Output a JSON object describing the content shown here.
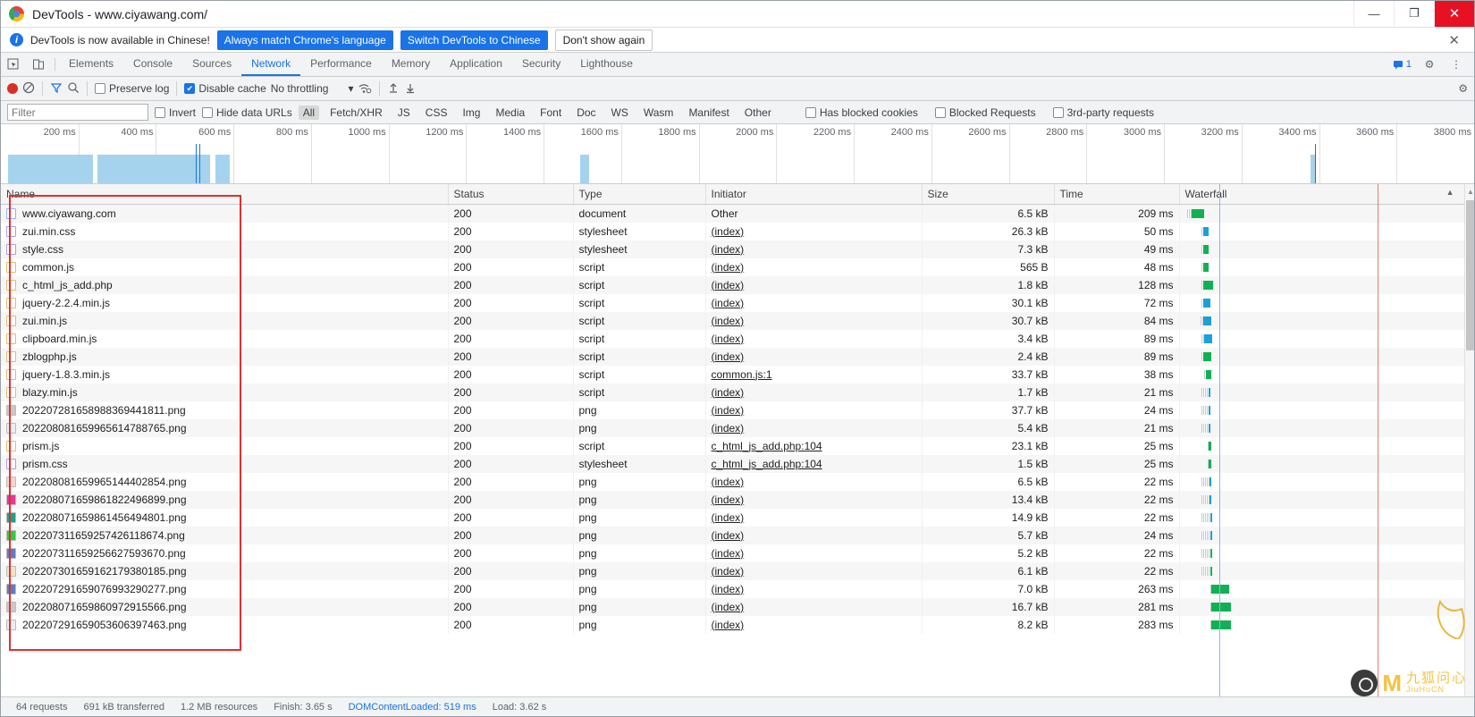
{
  "window": {
    "title": "DevTools - www.ciyawang.com/",
    "minimize": "—",
    "maximize": "❐",
    "close": "✕"
  },
  "banner": {
    "text": "DevTools is now available in Chinese!",
    "primary_button": "Always match Chrome's language",
    "secondary_button": "Switch DevTools to Chinese",
    "dismiss_button": "Don't show again",
    "close": "✕"
  },
  "tabs": [
    {
      "label": "Elements",
      "active": false
    },
    {
      "label": "Console",
      "active": false
    },
    {
      "label": "Sources",
      "active": false
    },
    {
      "label": "Network",
      "active": true
    },
    {
      "label": "Performance",
      "active": false
    },
    {
      "label": "Memory",
      "active": false
    },
    {
      "label": "Application",
      "active": false
    },
    {
      "label": "Security",
      "active": false
    },
    {
      "label": "Lighthouse",
      "active": false
    }
  ],
  "tabbar_right": {
    "message_count": "1",
    "settings": "⚙",
    "more": "⋮"
  },
  "net_toolbar": {
    "record_title": "record",
    "clear_title": "clear",
    "filter_title": "filter",
    "search_title": "search",
    "preserve_log": {
      "label": "Preserve log",
      "checked": false
    },
    "disable_cache": {
      "label": "Disable cache",
      "checked": true
    },
    "throttling": "No throttling",
    "throttle_caret": "▾",
    "import_title": "import HAR",
    "export_title": "export HAR",
    "settings": "⚙"
  },
  "filter_bar": {
    "placeholder": "Filter",
    "value": "",
    "invert": {
      "label": "Invert",
      "checked": false
    },
    "hide_data_urls": {
      "label": "Hide data URLs",
      "checked": false
    },
    "types": [
      "All",
      "Fetch/XHR",
      "JS",
      "CSS",
      "Img",
      "Media",
      "Font",
      "Doc",
      "WS",
      "Wasm",
      "Manifest",
      "Other"
    ],
    "active_type": "All",
    "has_blocked_cookies": {
      "label": "Has blocked cookies",
      "checked": false
    },
    "blocked_requests": {
      "label": "Blocked Requests",
      "checked": false
    },
    "third_party": {
      "label": "3rd-party requests",
      "checked": false
    }
  },
  "overview": {
    "ticks": [
      "200 ms",
      "400 ms",
      "600 ms",
      "800 ms",
      "1000 ms",
      "1200 ms",
      "1400 ms",
      "1600 ms",
      "1800 ms",
      "2000 ms",
      "2200 ms",
      "2400 ms",
      "2600 ms",
      "2800 ms",
      "3000 ms",
      "3200 ms",
      "3400 ms",
      "3600 ms",
      "3800 ms"
    ]
  },
  "table": {
    "columns": [
      "Name",
      "Status",
      "Type",
      "Initiator",
      "Size",
      "Time",
      "Waterfall"
    ],
    "sort_indicator": "▲",
    "rows": [
      {
        "name": "www.ciyawang.com",
        "icon": "doc",
        "status": "200",
        "type": "document",
        "initiator": "Other",
        "initiator_link": false,
        "size": "6.5 kB",
        "time": "209 ms",
        "wf_start": 8,
        "wf_wait": 5,
        "wf_len": 14,
        "wf_color": "#11b153"
      },
      {
        "name": "zui.min.css",
        "icon": "css",
        "status": "200",
        "type": "stylesheet",
        "initiator": "(index)",
        "initiator_link": true,
        "size": "26.3 kB",
        "time": "50 ms",
        "wf_start": 24,
        "wf_wait": 2,
        "wf_len": 6,
        "wf_color": "#1ca0d9"
      },
      {
        "name": "style.css",
        "icon": "css",
        "status": "200",
        "type": "stylesheet",
        "initiator": "(index)",
        "initiator_link": true,
        "size": "7.3 kB",
        "time": "49 ms",
        "wf_start": 24,
        "wf_wait": 2,
        "wf_len": 6,
        "wf_color": "#11b153"
      },
      {
        "name": "common.js",
        "icon": "js",
        "status": "200",
        "type": "script",
        "initiator": "(index)",
        "initiator_link": true,
        "size": "565 B",
        "time": "48 ms",
        "wf_start": 24,
        "wf_wait": 2,
        "wf_len": 6,
        "wf_color": "#11b153"
      },
      {
        "name": "c_html_js_add.php",
        "icon": "js",
        "status": "200",
        "type": "script",
        "initiator": "(index)",
        "initiator_link": true,
        "size": "1.8 kB",
        "time": "128 ms",
        "wf_start": 24,
        "wf_wait": 2,
        "wf_len": 11,
        "wf_color": "#11b153"
      },
      {
        "name": "jquery-2.2.4.min.js",
        "icon": "js",
        "status": "200",
        "type": "script",
        "initiator": "(index)",
        "initiator_link": true,
        "size": "30.1 kB",
        "time": "72 ms",
        "wf_start": 24,
        "wf_wait": 2,
        "wf_len": 8,
        "wf_color": "#1ca0d9"
      },
      {
        "name": "zui.min.js",
        "icon": "js",
        "status": "200",
        "type": "script",
        "initiator": "(index)",
        "initiator_link": true,
        "size": "30.7 kB",
        "time": "84 ms",
        "wf_start": 23,
        "wf_wait": 3,
        "wf_len": 9,
        "wf_color": "#1ca0d9"
      },
      {
        "name": "clipboard.min.js",
        "icon": "js",
        "status": "200",
        "type": "script",
        "initiator": "(index)",
        "initiator_link": true,
        "size": "3.4 kB",
        "time": "89 ms",
        "wf_start": 24,
        "wf_wait": 3,
        "wf_len": 9,
        "wf_color": "#1ca0d9"
      },
      {
        "name": "zblogphp.js",
        "icon": "js",
        "status": "200",
        "type": "script",
        "initiator": "(index)",
        "initiator_link": true,
        "size": "2.4 kB",
        "time": "89 ms",
        "wf_start": 24,
        "wf_wait": 2,
        "wf_len": 9,
        "wf_color": "#11b153"
      },
      {
        "name": "jquery-1.8.3.min.js",
        "icon": "js",
        "status": "200",
        "type": "script",
        "initiator": "common.js:1",
        "initiator_link": true,
        "size": "33.7 kB",
        "time": "38 ms",
        "wf_start": 27,
        "wf_wait": 2,
        "wf_len": 6,
        "wf_color": "#11b153"
      },
      {
        "name": "blazy.min.js",
        "icon": "js",
        "status": "200",
        "type": "script",
        "initiator": "(index)",
        "initiator_link": true,
        "size": "1.7 kB",
        "time": "21 ms",
        "wf_start": 24,
        "wf_wait": 8,
        "wf_len": 2,
        "wf_color": "#1ca0d9"
      },
      {
        "name": "20220728165898836944 1811.png",
        "icon": "img",
        "status": "200",
        "type": "png",
        "initiator": "(index)",
        "initiator_link": true,
        "size": "37.7 kB",
        "time": "24 ms",
        "wf_start": 24,
        "wf_wait": 8,
        "wf_len": 2,
        "wf_color": "#1ca0d9"
      },
      {
        "name": "20220808165996561478 8765.png",
        "icon": "img",
        "status": "200",
        "type": "png",
        "initiator": "(index)",
        "initiator_link": true,
        "size": "5.4 kB",
        "time": "21 ms",
        "wf_start": 24,
        "wf_wait": 8,
        "wf_len": 2,
        "wf_color": "#1ca0d9"
      },
      {
        "name": "prism.js",
        "icon": "js",
        "status": "200",
        "type": "script",
        "initiator": "c_html_js_add.php:104",
        "initiator_link": true,
        "size": "23.1 kB",
        "time": "25 ms",
        "wf_start": 31,
        "wf_wait": 1,
        "wf_len": 3,
        "wf_color": "#11b153"
      },
      {
        "name": "prism.css",
        "icon": "css",
        "status": "200",
        "type": "stylesheet",
        "initiator": "c_html_js_add.php:104",
        "initiator_link": true,
        "size": "1.5 kB",
        "time": "25 ms",
        "wf_start": 31,
        "wf_wait": 1,
        "wf_len": 3,
        "wf_color": "#11b153"
      },
      {
        "name": "20220808165996514440 2854.png",
        "icon": "img",
        "status": "200",
        "type": "png",
        "initiator": "(index)",
        "initiator_link": true,
        "size": "6.5 kB",
        "time": "22 ms",
        "wf_start": 24,
        "wf_wait": 9,
        "wf_len": 2,
        "wf_color": "#1ca0d9"
      },
      {
        "name": "20220807165986182249 6899.png",
        "icon": "img",
        "status": "200",
        "type": "png",
        "initiator": "(index)",
        "initiator_link": true,
        "size": "13.4 kB",
        "time": "22 ms",
        "wf_start": 24,
        "wf_wait": 9,
        "wf_len": 2,
        "wf_color": "#1ca0d9"
      },
      {
        "name": "20220807165986145649 4801.png",
        "icon": "img",
        "status": "200",
        "type": "png",
        "initiator": "(index)",
        "initiator_link": true,
        "size": "14.9 kB",
        "time": "22 ms",
        "wf_start": 24,
        "wf_wait": 10,
        "wf_len": 2,
        "wf_color": "#1ca0d9"
      },
      {
        "name": "20220731165925742611 8674.png",
        "icon": "img",
        "status": "200",
        "type": "png",
        "initiator": "(index)",
        "initiator_link": true,
        "size": "5.7 kB",
        "time": "24 ms",
        "wf_start": 24,
        "wf_wait": 10,
        "wf_len": 2,
        "wf_color": "#1ca0d9"
      },
      {
        "name": "20220731165925662759 3670.png",
        "icon": "img",
        "status": "200",
        "type": "png",
        "initiator": "(index)",
        "initiator_link": true,
        "size": "5.2 kB",
        "time": "22 ms",
        "wf_start": 24,
        "wf_wait": 10,
        "wf_len": 2,
        "wf_color": "#11b153"
      },
      {
        "name": "20220730165916217938 0185.png",
        "icon": "img",
        "status": "200",
        "type": "png",
        "initiator": "(index)",
        "initiator_link": true,
        "size": "6.1 kB",
        "time": "22 ms",
        "wf_start": 24,
        "wf_wait": 10,
        "wf_len": 2,
        "wf_color": "#11b153"
      },
      {
        "name": "20220729165907699329 0277.png",
        "icon": "img",
        "status": "200",
        "type": "png",
        "initiator": "(index)",
        "initiator_link": true,
        "size": "7.0 kB",
        "time": "263 ms",
        "wf_start": 34,
        "wf_wait": 1,
        "wf_len": 20,
        "wf_color": "#11b153"
      },
      {
        "name": "20220807165986097291 5566.png",
        "icon": "img",
        "status": "200",
        "type": "png",
        "initiator": "(index)",
        "initiator_link": true,
        "size": "16.7 kB",
        "time": "281 ms",
        "wf_start": 34,
        "wf_wait": 1,
        "wf_len": 22,
        "wf_color": "#11b153"
      },
      {
        "name": "20220729165905360639 7463.png",
        "icon": "img",
        "status": "200",
        "type": "png",
        "initiator": "(index)",
        "initiator_link": true,
        "size": "8.2 kB",
        "time": "283 ms",
        "wf_start": 34,
        "wf_wait": 1,
        "wf_len": 22,
        "wf_color": "#11b153"
      }
    ]
  },
  "status_bar": {
    "requests": "64 requests",
    "transferred": "691 kB transferred",
    "resources": "1.2 MB resources",
    "finish": "Finish: 3.65 s",
    "dom_content_loaded": "DOMContentLoaded: 519 ms",
    "load": "Load: 3.62 s"
  },
  "watermark": {
    "logo_letter": "M",
    "name_cn": "九狐问心",
    "name_en": "JiuHuCN"
  },
  "colors": {
    "accent": "#1a73e8",
    "record": "#d93025",
    "annotation": "#e03030",
    "green": "#11b153",
    "blue_bar": "#1ca0d9"
  }
}
